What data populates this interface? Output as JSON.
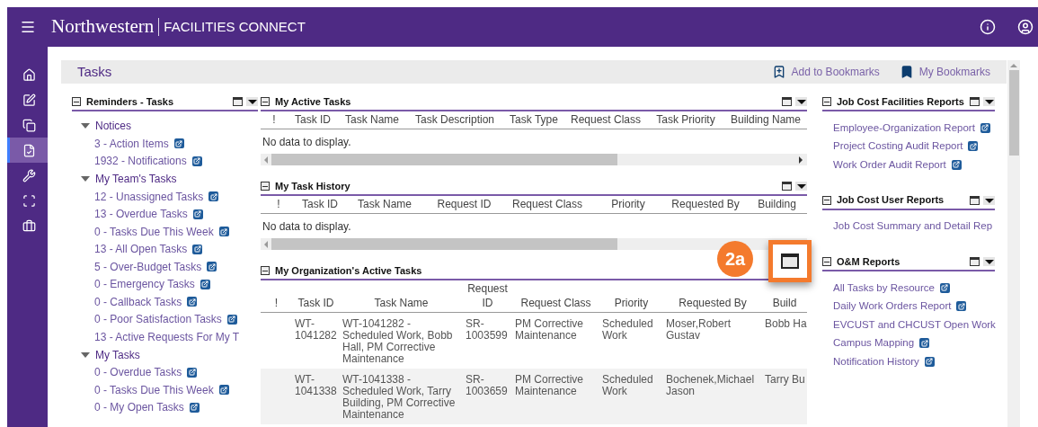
{
  "header": {
    "brand": "Northwestern",
    "product": "FACILITIES CONNECT"
  },
  "nav": [
    {
      "selected": false
    },
    {
      "selected": false
    },
    {
      "selected": false
    },
    {
      "selected": true
    },
    {
      "selected": false
    },
    {
      "selected": false
    },
    {
      "selected": false
    }
  ],
  "page": {
    "title": "Tasks",
    "actions": [
      {
        "label": "Add to Bookmarks"
      },
      {
        "label": "My Bookmarks"
      }
    ]
  },
  "reminders": {
    "title": "Reminders - Tasks",
    "groups": [
      {
        "label": "Notices",
        "expanded": true,
        "children": [
          {
            "label": "3 - Action Items",
            "link_icon": true
          },
          {
            "label": "1932 - Notifications",
            "link_icon": true
          }
        ]
      },
      {
        "label": "My Team's Tasks",
        "expanded": true,
        "children": [
          {
            "label": "12 - Unassigned Tasks",
            "link_icon": true
          },
          {
            "label": "13 - Overdue Tasks",
            "link_icon": true
          },
          {
            "label": "0 - Tasks Due This Week",
            "link_icon": true
          },
          {
            "label": "13 - All Open Tasks",
            "link_icon": true
          },
          {
            "label": "5 - Over-Budget Tasks",
            "link_icon": true
          },
          {
            "label": "0 - Emergency Tasks",
            "link_icon": true
          },
          {
            "label": "0 - Callback Tasks",
            "link_icon": true
          },
          {
            "label": "0 - Poor Satisfaction Tasks",
            "link_icon": true
          },
          {
            "label": "13 - Active Requests For My T",
            "link_icon": false
          }
        ]
      },
      {
        "label": "My Tasks",
        "expanded": true,
        "children": [
          {
            "label": "0 - Overdue Tasks",
            "link_icon": true
          },
          {
            "label": "0 - Tasks Due This Week",
            "link_icon": true
          },
          {
            "label": "0 - My Open Tasks",
            "link_icon": true
          }
        ]
      }
    ]
  },
  "panels": [
    {
      "title": "My Active Tasks",
      "columns": [
        "!",
        "Task ID",
        "Task Name",
        "Task Description",
        "Task Type",
        "Request Class",
        "Task Priority",
        "Building Name"
      ],
      "empty": "No data to display."
    },
    {
      "title": "My Task History",
      "columns": [
        "!",
        "Task ID",
        "Task Name",
        "Request ID",
        "Request Class",
        "Priority",
        "Requested By",
        "Building"
      ],
      "empty": "No data to display."
    }
  ],
  "org_tasks": {
    "title": "My Organization's Active Tasks",
    "callout": "2a",
    "columns": [
      "!",
      "Task ID",
      "Task Name",
      "Request ID",
      "Request Class",
      "Priority",
      "Requested By",
      "Build"
    ],
    "rows": [
      [
        "",
        "WT-1041282",
        "WT-1041282 - Scheduled Work, Bobb Hall, PM Corrective Maintenance",
        "SR-1003599",
        "PM Corrective Maintenance",
        "Scheduled Work",
        "Moser,Robert Gustav",
        "Bobb Ha"
      ],
      [
        "",
        "WT-1041338",
        "WT-1041338 - Scheduled Work, Tarry Building, PM Corrective Maintenance",
        "SR-1003659",
        "PM Corrective Maintenance",
        "Scheduled Work",
        "Bochenek,Michael Jason",
        "Tarry Bu"
      ]
    ]
  },
  "reports": [
    {
      "title": "Job Cost Facilities Reports",
      "links": [
        {
          "label": "Employee-Organization Report",
          "link_icon": true
        },
        {
          "label": "Project Costing Audit Report",
          "link_icon": true
        },
        {
          "label": "Work Order Audit Report",
          "link_icon": true
        }
      ]
    },
    {
      "title": "Job Cost User Reports",
      "links": [
        {
          "label": "Job Cost Summary and Detail Rep",
          "link_icon": false
        }
      ]
    },
    {
      "title": "O&M Reports",
      "links": [
        {
          "label": "All Tasks by Resource",
          "link_icon": true
        },
        {
          "label": "Daily Work Orders Report",
          "link_icon": true
        },
        {
          "label": "EVCUST and CHCUST Open Work",
          "link_icon": false
        },
        {
          "label": "Campus Mapping",
          "link_icon": true
        },
        {
          "label": "Notification History",
          "link_icon": true
        }
      ]
    }
  ]
}
